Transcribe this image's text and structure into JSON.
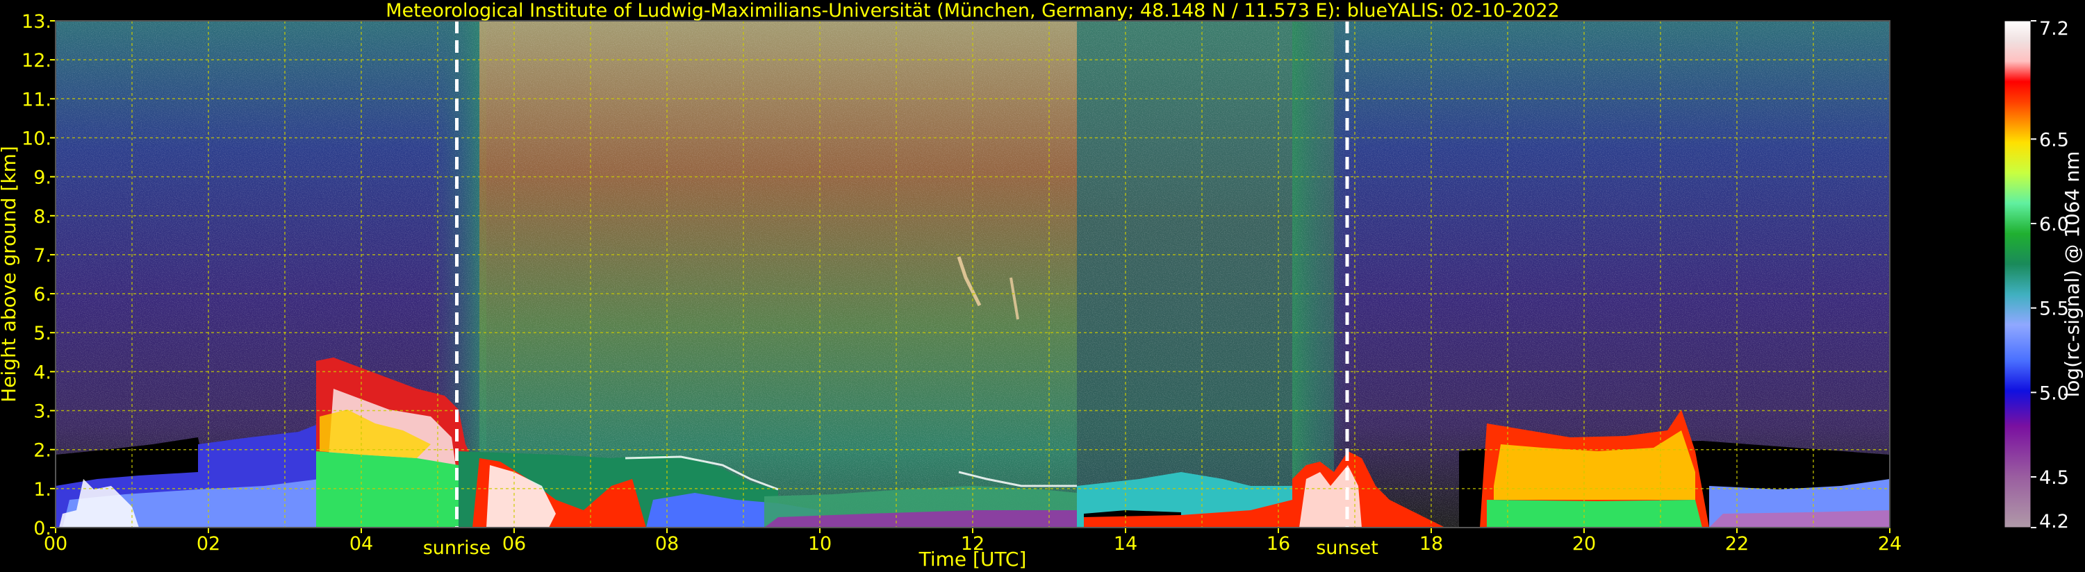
{
  "chart_data": {
    "type": "heatmap",
    "title": "Meteorological Institute of Ludwig-Maximilians-Universität (München, Germany; 48.148 N / 11.573 E):     blueYALIS: 02-10-2022",
    "xlabel": "Time [UTC]",
    "ylabel": "Height above ground [km]",
    "colorbar_label": "log(rc-signal) @ 1064 nm",
    "xlim": [
      0,
      24
    ],
    "ylim": [
      0,
      13
    ],
    "x_ticks": [
      "00",
      "02",
      "04",
      "06",
      "08",
      "10",
      "12",
      "14",
      "16",
      "18",
      "20",
      "22",
      "24"
    ],
    "y_ticks": [
      "0.",
      "1.",
      "2.",
      "3.",
      "4.",
      "5.",
      "6.",
      "7.",
      "8.",
      "9.",
      "10.",
      "11.",
      "12.",
      "13."
    ],
    "colorbar_ticks": [
      "4.2",
      "4.5",
      "5.0",
      "5.5",
      "6.0",
      "6.5",
      "7.2"
    ],
    "colorbar_range": [
      4.2,
      7.2
    ],
    "annotations": [
      {
        "label": "sunrise",
        "time": 5.25
      },
      {
        "label": "sunset",
        "time": 16.9
      }
    ],
    "grid": true,
    "colors": {
      "text": "#ffff00",
      "grid": "#cccc00",
      "background": "#000000",
      "frame": "#444444",
      "colorbar_text": "#ffffff"
    }
  }
}
